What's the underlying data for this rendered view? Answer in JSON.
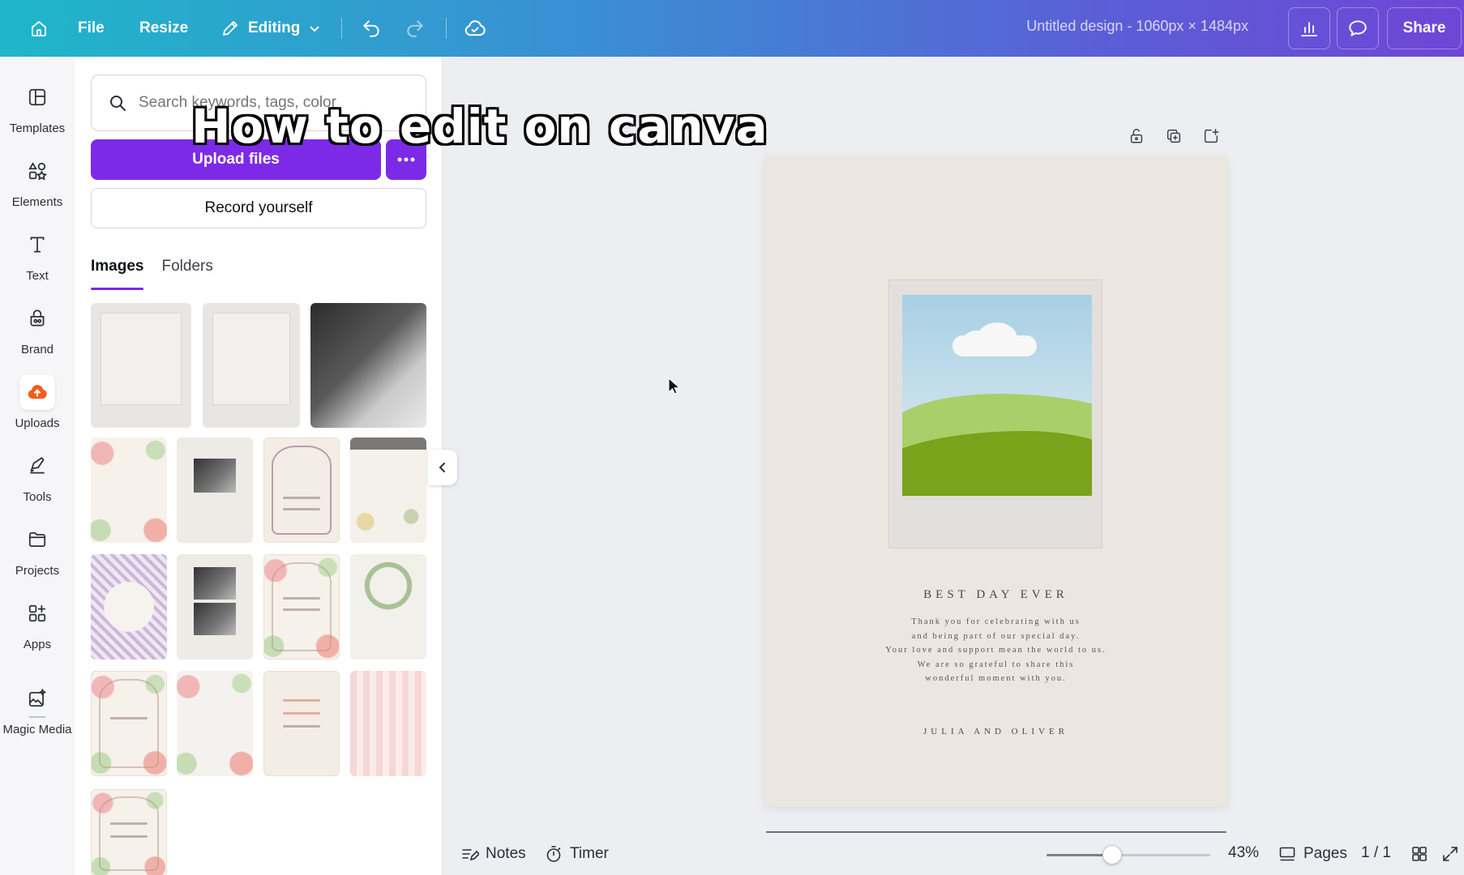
{
  "overlay": {
    "title": "How to edit on canva"
  },
  "topbar": {
    "file_label": "File",
    "resize_label": "Resize",
    "mode_label": "Editing",
    "document_title": "Untitled design - 1060px × 1484px",
    "share_label": "Share",
    "icons": [
      "home-icon",
      "pencil-icon",
      "chevron-down-icon",
      "undo-icon",
      "redo-icon",
      "cloud-check-icon",
      "bar-chart-icon",
      "comment-icon"
    ],
    "gradient_colors": [
      "#1fb6c9",
      "#3a8fd3",
      "#5a5fd6",
      "#6f46d6"
    ]
  },
  "rail": {
    "items": [
      {
        "label": "Templates",
        "icon": "templates-icon"
      },
      {
        "label": "Elements",
        "icon": "elements-icon"
      },
      {
        "label": "Text",
        "icon": "text-icon"
      },
      {
        "label": "Brand",
        "icon": "brand-icon"
      },
      {
        "label": "Uploads",
        "icon": "cloud-upload-icon",
        "active": true
      },
      {
        "label": "Tools",
        "icon": "pen-tool-icon"
      },
      {
        "label": "Projects",
        "icon": "folder-icon"
      },
      {
        "label": "Apps",
        "icon": "apps-icon"
      },
      {
        "label": "Magic Media",
        "icon": "magic-media-icon"
      }
    ]
  },
  "uploads": {
    "search_placeholder": "Search keywords, tags, color",
    "upload_label": "Upload files",
    "record_label": "Record yourself",
    "tabs": [
      {
        "label": "Images",
        "active": true
      },
      {
        "label": "Folders",
        "active": false
      }
    ],
    "accent": "#7d2ae8"
  },
  "invitation": {
    "heading": "BEST DAY EVER",
    "body_lines": [
      "Thank you for celebrating with us",
      "and being part of our special day.",
      "Your love and support mean the world to us.",
      "We are so grateful to share this",
      "wonderful moment with you."
    ],
    "names": "JULIA AND OLIVER",
    "background": "#ece6e1"
  },
  "bottombar": {
    "notes_label": "Notes",
    "timer_label": "Timer",
    "zoom_label": "43%",
    "zoom_level": 0.4,
    "pages_label": "Pages",
    "page_counter": "1 / 1"
  }
}
